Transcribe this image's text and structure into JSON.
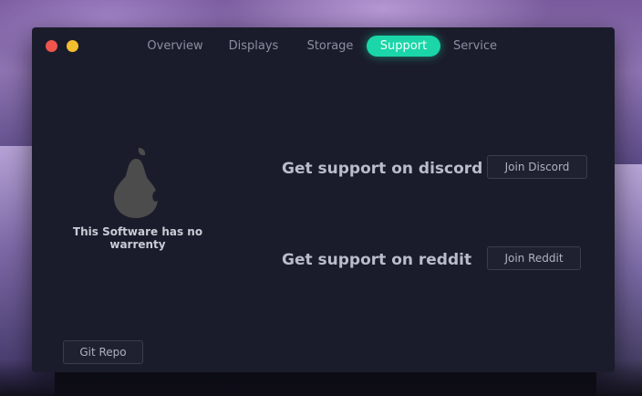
{
  "window": {
    "tabs": [
      {
        "label": "Overview",
        "active": false
      },
      {
        "label": "Displays",
        "active": false
      },
      {
        "label": "Storage",
        "active": false
      },
      {
        "label": "Support",
        "active": true
      },
      {
        "label": "Service",
        "active": false
      }
    ],
    "warranty_text": "This Software has no warrenty",
    "discord": {
      "text": "Get support on discord",
      "button": "Join Discord"
    },
    "reddit": {
      "text": "Get support on reddit",
      "button": "Join Reddit"
    },
    "git_button": "Git Repo"
  },
  "colors": {
    "accent": "#1ad6a8",
    "close": "#f0544c",
    "minimize": "#f5be2e",
    "window_bg": "#1b1c2b"
  },
  "icons": [
    "close-icon",
    "minimize-icon",
    "pear-logo-icon"
  ]
}
